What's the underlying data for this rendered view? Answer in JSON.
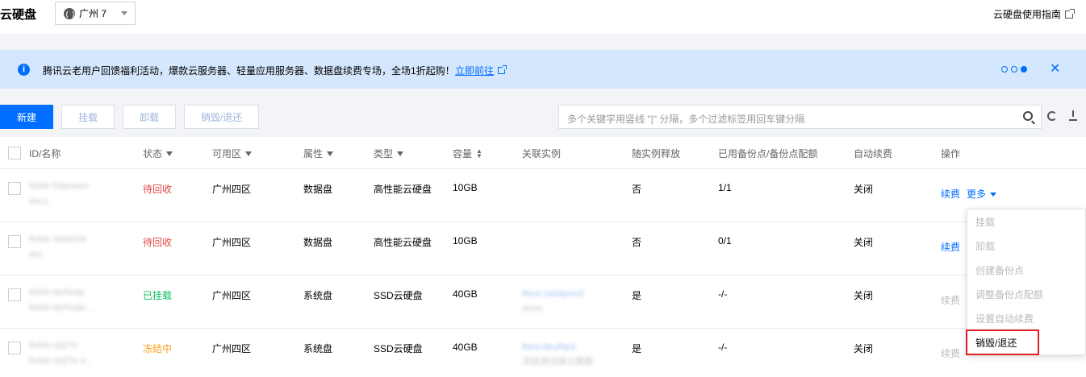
{
  "header": {
    "title": "云硬盘",
    "region": "广州 7",
    "guide": "云硬盘使用指南"
  },
  "banner": {
    "text": "腾讯云老用户回馈福利活动，爆款云服务器、轻量应用服务器、数据盘续费专场，全场1折起购！",
    "link": "立即前往",
    "close": "✕"
  },
  "toolbar": {
    "new": "新建",
    "attach": "挂载",
    "detach": "卸载",
    "destroy": "销毁/退还",
    "search_placeholder": "多个关键字用竖线 \"|\" 分隔，多个过滤标签用回车键分隔"
  },
  "table": {
    "headers": [
      "ID/名称",
      "状态",
      "可用区",
      "属性",
      "类型",
      "容量",
      "关联实例",
      "随实例释放",
      "已用备份点/备份点配额",
      "自动续费",
      "操作"
    ],
    "rows": [
      {
        "id": "lhdsk-hdpssem",
        "name": "doc1",
        "status": "待回收",
        "zone": "广州四区",
        "attr": "数据盘",
        "type": "高性能云硬盘",
        "size": "10GB",
        "inst_id": "",
        "inst_name": "",
        "release": "否",
        "backup": "1/1",
        "renew": "关闭",
        "op1": "续费",
        "op2": "更多"
      },
      {
        "id": "lhdsk-3aedx0e",
        "name": "doc",
        "status": "待回收",
        "zone": "广州四区",
        "attr": "数据盘",
        "type": "高性能云硬盘",
        "size": "10GB",
        "inst_id": "",
        "inst_name": "",
        "release": "否",
        "backup": "0/1",
        "renew": "关闭",
        "op1": "续费",
        "op2": ""
      },
      {
        "id": "lhdsk-0prfsaip",
        "name": "lhdsk-0prfsaip-...",
        "status": "已挂载",
        "zone": "广州四区",
        "attr": "系统盘",
        "type": "SSD云硬盘",
        "size": "40GB",
        "inst_id": "lhins-1kb4ymo2",
        "inst_name": "wooc",
        "release": "是",
        "backup": "-/-",
        "renew": "关闭",
        "op1": "续费",
        "op2": ""
      },
      {
        "id": "lhdsk-nj0j7lv",
        "name": "lhdsk-nj0j7lv-o...",
        "status": "冻结中",
        "zone": "广州四区",
        "attr": "系统盘",
        "type": "SSD云硬盘",
        "size": "40GB",
        "inst_id": "lhins-8euf0p3",
        "inst_name": "冻结测试保立硬盘",
        "release": "是",
        "backup": "-/-",
        "renew": "关闭",
        "op1": "续费",
        "op2": ""
      }
    ]
  },
  "dropdown": {
    "items": [
      "挂载",
      "卸载",
      "创建备份点",
      "调整备份点配额",
      "设置自动续费",
      "销毁/退还"
    ]
  }
}
